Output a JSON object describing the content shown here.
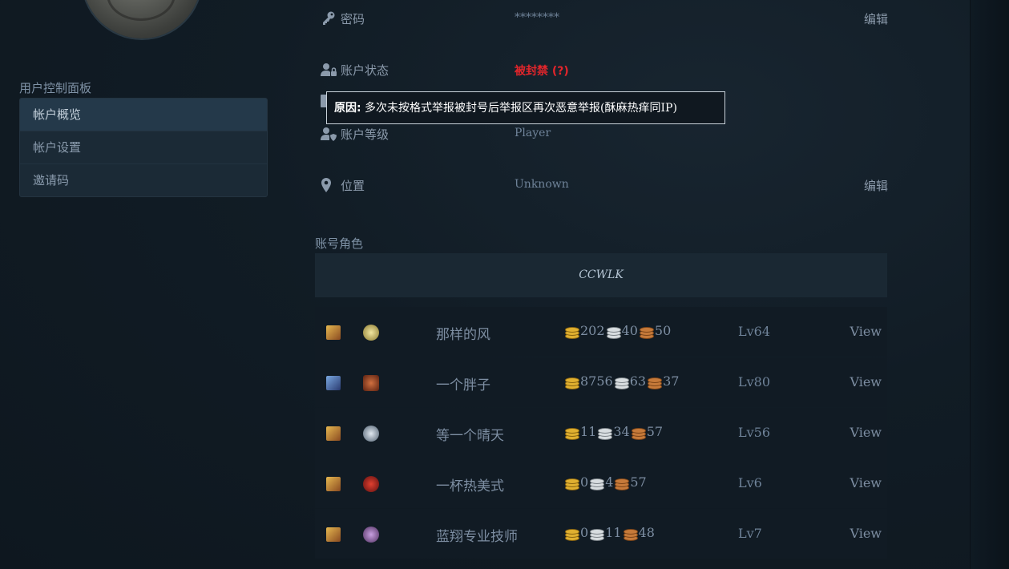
{
  "sidebar": {
    "panel_title": "用户控制面板",
    "items": [
      {
        "label": "帐户概览"
      },
      {
        "label": "帐户设置"
      },
      {
        "label": "邀请码"
      }
    ]
  },
  "account": {
    "password": {
      "label": "密码",
      "value": "********",
      "edit": "编辑",
      "icon": "key-icon"
    },
    "status": {
      "label": "账户状态",
      "value": "被封禁 (?)",
      "icon": "user-lock-icon",
      "color": "#e2252b"
    },
    "level": {
      "label": "账户等级",
      "value": "Player",
      "icon": "user-shield-icon"
    },
    "location": {
      "label": "位置",
      "value": "Unknown",
      "edit": "编辑",
      "icon": "map-pin-icon"
    }
  },
  "tooltip": {
    "prefix": "原因:",
    "text": " 多次未按格式举报被封号后举报区再次恶意举报(酥麻热痒同IP)"
  },
  "characters": {
    "title": "账号角色",
    "realm": "CCWLK",
    "rows": [
      {
        "name": "那样的风",
        "gold": "202",
        "silver": "40",
        "copper": "50",
        "level": "Lv64",
        "view": "View",
        "race_icon": "human-female-icon",
        "class_icon": "class-icon"
      },
      {
        "name": "一个胖子",
        "gold": "8756",
        "silver": "63",
        "copper": "37",
        "level": "Lv80",
        "view": "View",
        "race_icon": "draenei-icon",
        "class_icon": "class-icon"
      },
      {
        "name": "等一个晴天",
        "gold": "11",
        "silver": "34",
        "copper": "57",
        "level": "Lv56",
        "view": "View",
        "race_icon": "human-female-icon",
        "class_icon": "class-icon"
      },
      {
        "name": "一杯热美式",
        "gold": "0",
        "silver": "4",
        "copper": "57",
        "level": "Lv6",
        "view": "View",
        "race_icon": "human-female-icon",
        "class_icon": "class-icon"
      },
      {
        "name": "蓝翔专业技师",
        "gold": "0",
        "silver": "11",
        "copper": "48",
        "level": "Lv7",
        "view": "View",
        "race_icon": "human-female-icon",
        "class_icon": "class-icon"
      }
    ]
  }
}
